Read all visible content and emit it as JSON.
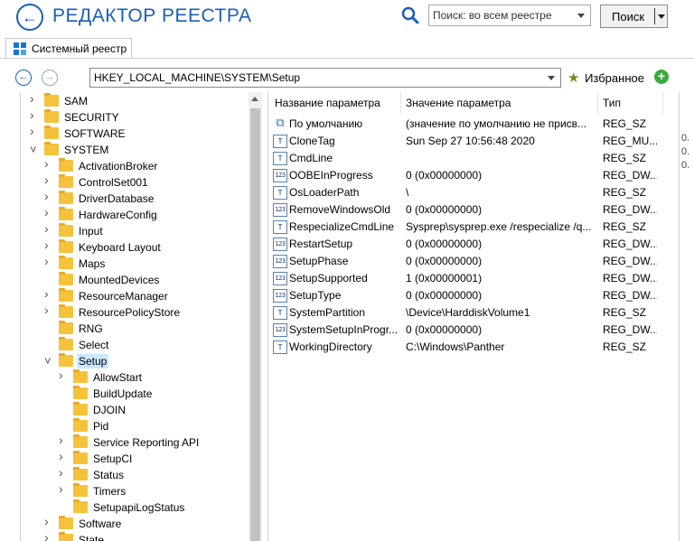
{
  "app": {
    "title": "РЕДАКТОР РЕЕСТРА"
  },
  "search": {
    "placeholder": "Поиск: во всем реестре",
    "button_label": "Поиск"
  },
  "tabs": [
    {
      "label": "Системный реестр"
    }
  ],
  "address": {
    "path": "HKEY_LOCAL_MACHINE\\SYSTEM\\Setup",
    "favorites_label": "Избранное"
  },
  "tree": {
    "items": [
      {
        "label": "SAM",
        "indent": 0,
        "expander": "collapsed"
      },
      {
        "label": "SECURITY",
        "indent": 0,
        "expander": "collapsed"
      },
      {
        "label": "SOFTWARE",
        "indent": 0,
        "expander": "collapsed"
      },
      {
        "label": "SYSTEM",
        "indent": 0,
        "expander": "expanded"
      },
      {
        "label": "ActivationBroker",
        "indent": 1,
        "expander": "collapsed"
      },
      {
        "label": "ControlSet001",
        "indent": 1,
        "expander": "collapsed"
      },
      {
        "label": "DriverDatabase",
        "indent": 1,
        "expander": "collapsed"
      },
      {
        "label": "HardwareConfig",
        "indent": 1,
        "expander": "collapsed"
      },
      {
        "label": "Input",
        "indent": 1,
        "expander": "collapsed"
      },
      {
        "label": "Keyboard Layout",
        "indent": 1,
        "expander": "collapsed"
      },
      {
        "label": "Maps",
        "indent": 1,
        "expander": "collapsed"
      },
      {
        "label": "MountedDevices",
        "indent": 1,
        "expander": "none"
      },
      {
        "label": "ResourceManager",
        "indent": 1,
        "expander": "collapsed"
      },
      {
        "label": "ResourcePolicyStore",
        "indent": 1,
        "expander": "collapsed"
      },
      {
        "label": "RNG",
        "indent": 1,
        "expander": "none"
      },
      {
        "label": "Select",
        "indent": 1,
        "expander": "none"
      },
      {
        "label": "Setup",
        "indent": 1,
        "expander": "expanded",
        "selected": true
      },
      {
        "label": "AllowStart",
        "indent": 2,
        "expander": "collapsed"
      },
      {
        "label": "BuildUpdate",
        "indent": 2,
        "expander": "none"
      },
      {
        "label": "DJOIN",
        "indent": 2,
        "expander": "none"
      },
      {
        "label": "Pid",
        "indent": 2,
        "expander": "none"
      },
      {
        "label": "Service Reporting API",
        "indent": 2,
        "expander": "collapsed"
      },
      {
        "label": "SetupCI",
        "indent": 2,
        "expander": "collapsed"
      },
      {
        "label": "Status",
        "indent": 2,
        "expander": "collapsed"
      },
      {
        "label": "Timers",
        "indent": 2,
        "expander": "collapsed"
      },
      {
        "label": "SetupapiLogStatus",
        "indent": 2,
        "expander": "none"
      },
      {
        "label": "Software",
        "indent": 1,
        "expander": "collapsed"
      },
      {
        "label": "State",
        "indent": 1,
        "expander": "collapsed"
      }
    ]
  },
  "values": {
    "columns": {
      "name": "Название параметра",
      "value": "Значение параметра",
      "type": "Тип"
    },
    "rows": [
      {
        "name": "По умолчанию",
        "value": "(значение по умолчанию не присв...",
        "type": "REG_SZ",
        "icon": "default-value-icon"
      },
      {
        "name": "CloneTag",
        "value": "Sun Sep 27 10:56:48 2020",
        "type": "REG_MU...",
        "icon": "string-value-icon"
      },
      {
        "name": "CmdLine",
        "value": "",
        "type": "REG_SZ",
        "icon": "string-value-icon"
      },
      {
        "name": "OOBEInProgress",
        "value": "0 (0x00000000)",
        "type": "REG_DW...",
        "icon": "dword-value-icon"
      },
      {
        "name": "OsLoaderPath",
        "value": "\\",
        "type": "REG_SZ",
        "icon": "string-value-icon"
      },
      {
        "name": "RemoveWindowsOld",
        "value": "0 (0x00000000)",
        "type": "REG_DW...",
        "icon": "dword-value-icon"
      },
      {
        "name": "RespecializeCmdLine",
        "value": "Sysprep\\sysprep.exe /respecialize /q...",
        "type": "REG_SZ",
        "icon": "string-value-icon"
      },
      {
        "name": "RestartSetup",
        "value": "0 (0x00000000)",
        "type": "REG_DW...",
        "icon": "dword-value-icon"
      },
      {
        "name": "SetupPhase",
        "value": "0 (0x00000000)",
        "type": "REG_DW...",
        "icon": "dword-value-icon"
      },
      {
        "name": "SetupSupported",
        "value": "1 (0x00000001)",
        "type": "REG_DW...",
        "icon": "dword-value-icon"
      },
      {
        "name": "SetupType",
        "value": "0 (0x00000000)",
        "type": "REG_DW...",
        "icon": "dword-value-icon"
      },
      {
        "name": "SystemPartition",
        "value": "\\Device\\HarddiskVolume1",
        "type": "REG_SZ",
        "icon": "string-value-icon"
      },
      {
        "name": "SystemSetupInProgr...",
        "value": "0 (0x00000000)",
        "type": "REG_DW...",
        "icon": "dword-value-icon"
      },
      {
        "name": "WorkingDirectory",
        "value": "C:\\Windows\\Panther",
        "type": "REG_SZ",
        "icon": "string-value-icon"
      }
    ]
  },
  "edge_marks": [
    "0.",
    "0.",
    "0."
  ],
  "colors": {
    "accent": "#1a5fb4",
    "folder": "#f5c33b",
    "selection": "#cce8ff"
  }
}
